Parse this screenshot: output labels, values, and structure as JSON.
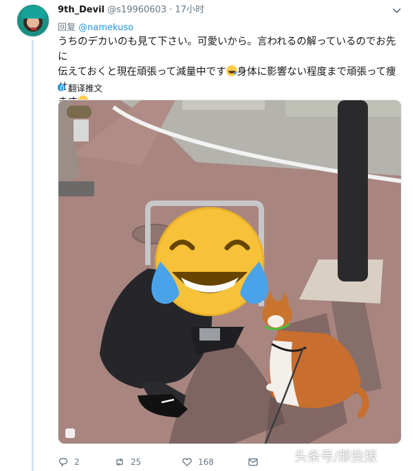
{
  "tweet": {
    "display_name": "9th_Devil",
    "handle": "@s19960603",
    "separator": "·",
    "time": "17小时",
    "reply_prefix": "回复",
    "reply_to": "@namekuso",
    "text_line1": "うちのデカいのも見て下さい。可愛いから。言われるの解っているのでお先に",
    "text_line2_a": "伝えておくと現在頑張って減量中です",
    "text_line2_b": "身体に影響ない程度まで頑張って痩せ",
    "text_line3": "ます",
    "translate_label": "翻译推文"
  },
  "actions": {
    "replies": "2",
    "retweets": "25",
    "likes": "168"
  },
  "icons": [
    "chevron-down-icon",
    "globe-icon",
    "reply-icon",
    "retweet-icon",
    "heart-icon",
    "message-icon",
    "expand-icon",
    "laughing-tears-emoji"
  ],
  "watermark": "头条号/那些报",
  "colors": {
    "link": "#1b95e0",
    "muted": "#657786",
    "thread": "#cfe3f3"
  }
}
